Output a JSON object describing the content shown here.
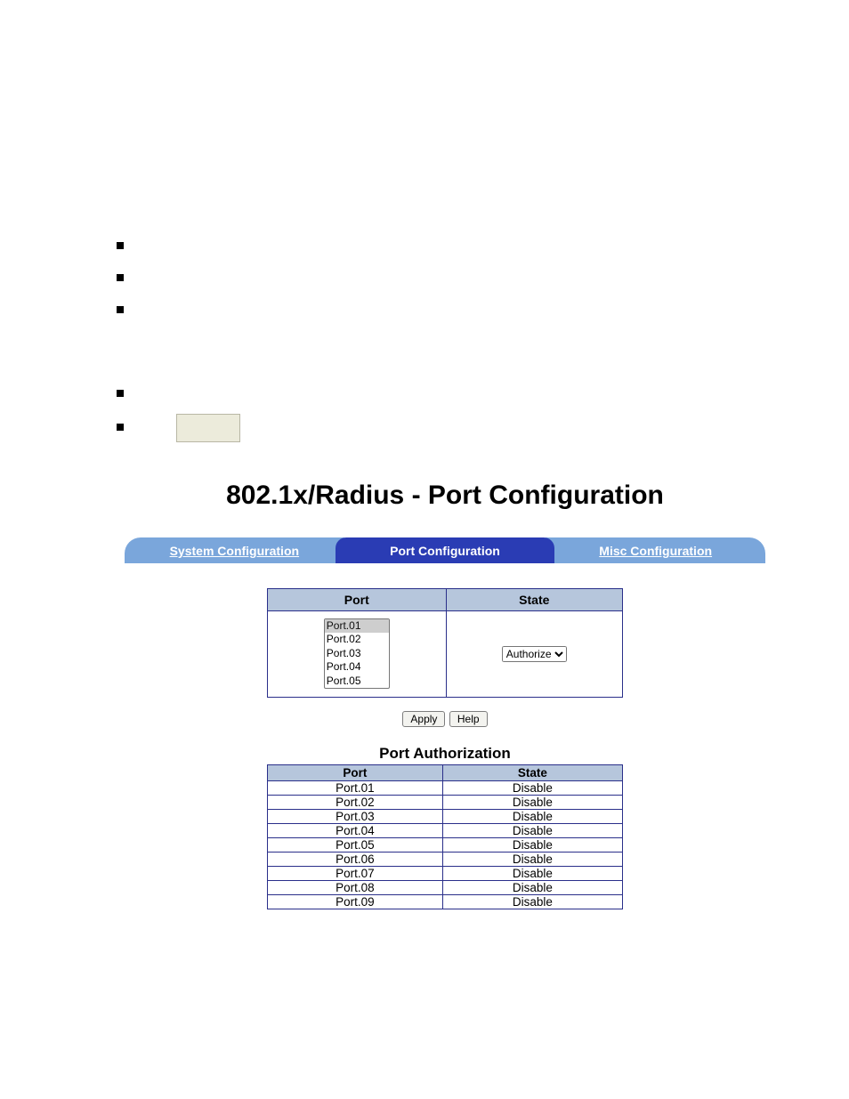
{
  "title": "802.1x/Radius - Port Configuration",
  "tabs": {
    "system": "System Configuration",
    "port": "Port Configuration",
    "misc": "Misc Configuration"
  },
  "cfg": {
    "port_header": "Port",
    "state_header": "State",
    "port_options": [
      "Port.01",
      "Port.02",
      "Port.03",
      "Port.04",
      "Port.05"
    ],
    "state_selected": "Authorize"
  },
  "buttons": {
    "apply": "Apply",
    "help": "Help"
  },
  "port_auth": {
    "title": "Port Authorization",
    "headers": {
      "port": "Port",
      "state": "State"
    },
    "rows": [
      {
        "port": "Port.01",
        "state": "Disable"
      },
      {
        "port": "Port.02",
        "state": "Disable"
      },
      {
        "port": "Port.03",
        "state": "Disable"
      },
      {
        "port": "Port.04",
        "state": "Disable"
      },
      {
        "port": "Port.05",
        "state": "Disable"
      },
      {
        "port": "Port.06",
        "state": "Disable"
      },
      {
        "port": "Port.07",
        "state": "Disable"
      },
      {
        "port": "Port.08",
        "state": "Disable"
      },
      {
        "port": "Port.09",
        "state": "Disable"
      }
    ]
  }
}
